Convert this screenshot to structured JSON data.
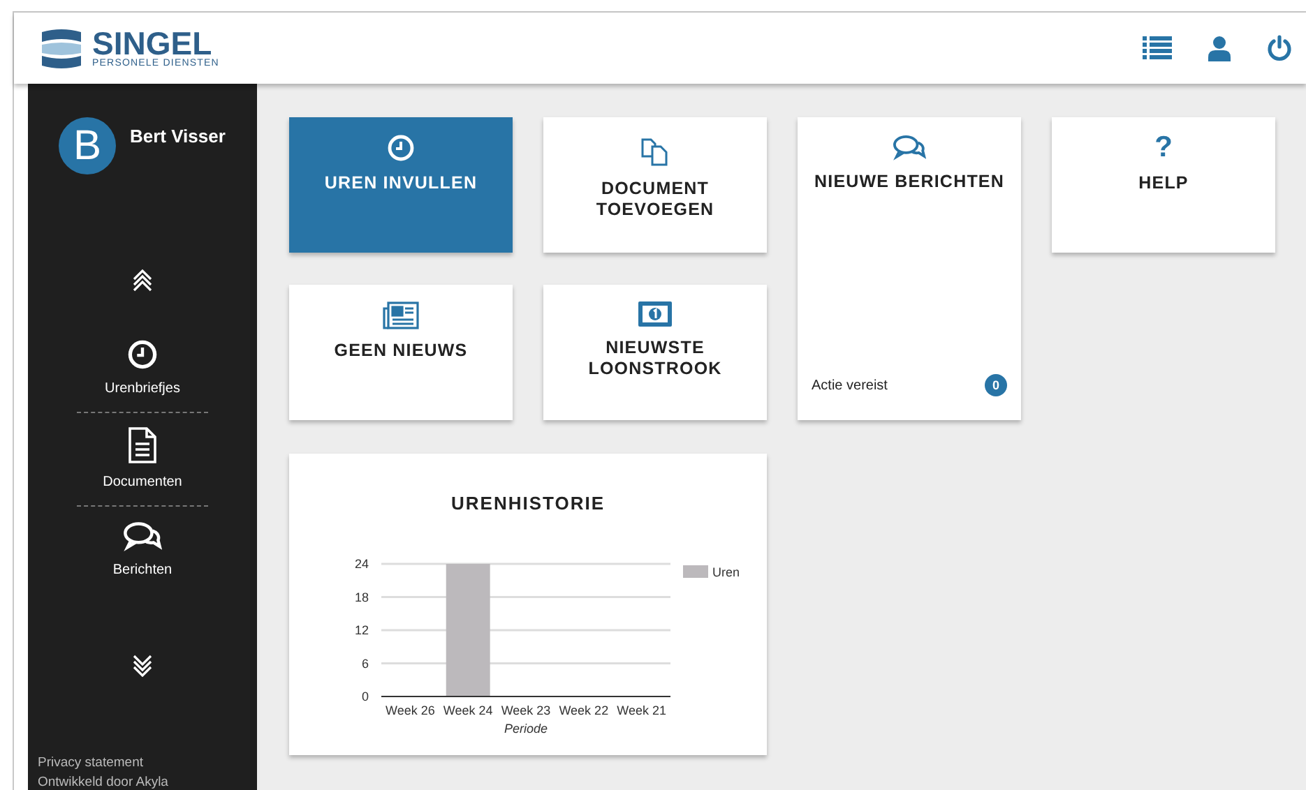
{
  "header": {
    "logo_title": "SINGEL",
    "logo_subtitle": "PERSONELE DIENSTEN"
  },
  "sidebar": {
    "avatar_letter": "B",
    "user_name": "Bert Visser",
    "items": [
      {
        "label": "Urenbriefjes"
      },
      {
        "label": "Documenten"
      },
      {
        "label": "Berichten"
      }
    ],
    "footer": [
      "Privacy statement",
      "Ontwikkeld door Akyla"
    ]
  },
  "tiles": [
    {
      "title": "UREN INVULLEN",
      "selected": true
    },
    {
      "title": "DOCUMENT TOEVOEGEN",
      "selected": false
    },
    {
      "title": "NIEUWE BERICHTEN",
      "selected": false,
      "footer_label": "Actie vereist",
      "count": "0"
    },
    {
      "title": "HELP",
      "selected": false,
      "symbol": "?"
    },
    {
      "title": "GEEN NIEUWS",
      "selected": false
    },
    {
      "title": "NIEUWSTE LOONSTROOK",
      "selected": false
    }
  ],
  "chart_card": {
    "title": "URENHISTORIE",
    "chart_data": {
      "type": "bar",
      "xlabel": "Periode",
      "categories": [
        "Week 26",
        "Week 24",
        "Week 23",
        "Week 22",
        "Week 21"
      ],
      "series": [
        {
          "name": "Uren",
          "color": "#bcb9bc",
          "values": [
            0,
            24,
            0,
            0,
            0
          ]
        }
      ],
      "ylim": [
        0,
        24
      ],
      "grid": true,
      "yticks": [
        0,
        6,
        12,
        18,
        24
      ]
    }
  }
}
